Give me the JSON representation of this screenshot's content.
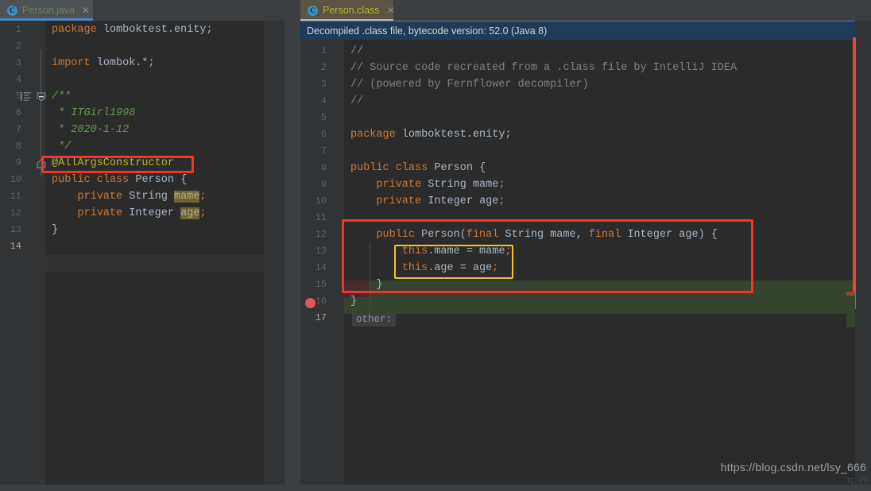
{
  "app": {
    "theme": "darcula",
    "watermark": "https://blog.csdn.net/lsy_666",
    "watermark_sub": "5.0",
    "accent_blue": "#4a88c7",
    "annotation_red": "#f5342a",
    "annotation_yellow": "#f0c419"
  },
  "tabs": [
    {
      "id": "tab-java",
      "label": "Person.java",
      "icon": "java-class-icon",
      "close_icon": "close-icon",
      "active": false,
      "underlined": true
    },
    {
      "id": "tab-class",
      "label": "Person.class",
      "icon": "java-class-icon",
      "close_icon": "close-icon",
      "active": true,
      "underlined": true
    }
  ],
  "left_editor": {
    "name": "Person.java",
    "cursor_line": 14,
    "line_numbers": [
      1,
      2,
      3,
      4,
      5,
      6,
      7,
      8,
      9,
      10,
      11,
      12,
      13,
      14
    ],
    "lines": [
      {
        "n": 1,
        "text": "package lomboktest.enity;"
      },
      {
        "n": 2,
        "text": ""
      },
      {
        "n": 3,
        "text": "import lombok.*;"
      },
      {
        "n": 4,
        "text": ""
      },
      {
        "n": 5,
        "text": "/**"
      },
      {
        "n": 6,
        "text": " * ITGirl1998"
      },
      {
        "n": 7,
        "text": " * 2020-1-12"
      },
      {
        "n": 8,
        "text": " */"
      },
      {
        "n": 9,
        "text": "@AllArgsConstructor"
      },
      {
        "n": 10,
        "text": "public class Person {"
      },
      {
        "n": 11,
        "text": "    private String mame;"
      },
      {
        "n": 12,
        "text": "    private Integer age;"
      },
      {
        "n": 13,
        "text": "}"
      },
      {
        "n": 14,
        "text": ""
      }
    ],
    "gutter_icons": [
      "reformat-icon",
      "fold-collapse-icon",
      "fold-end-icon"
    ],
    "stripe_markers": [
      "warning-square",
      "warning-line",
      "warning-line"
    ]
  },
  "right_editor": {
    "name": "Person.class",
    "notice": "Decompiled .class file, bytecode version: 52.0 (Java 8)",
    "breakpoint_line": 15,
    "line_numbers": [
      1,
      2,
      3,
      4,
      5,
      6,
      7,
      8,
      9,
      10,
      11,
      12,
      13,
      14,
      15,
      16,
      17
    ],
    "lines": [
      {
        "n": 1,
        "text": "//"
      },
      {
        "n": 2,
        "text": "// Source code recreated from a .class file by IntelliJ IDEA"
      },
      {
        "n": 3,
        "text": "// (powered by Fernflower decompiler)"
      },
      {
        "n": 4,
        "text": "//"
      },
      {
        "n": 5,
        "text": ""
      },
      {
        "n": 6,
        "text": "package lomboktest.enity;"
      },
      {
        "n": 7,
        "text": ""
      },
      {
        "n": 8,
        "text": "public class Person {"
      },
      {
        "n": 9,
        "text": "    private String mame;"
      },
      {
        "n": 10,
        "text": "    private Integer age;"
      },
      {
        "n": 11,
        "text": ""
      },
      {
        "n": 12,
        "text": "    public Person(final String mame, final Integer age) {"
      },
      {
        "n": 13,
        "text": "        this.mame = mame;"
      },
      {
        "n": 14,
        "text": "        this.age = age;"
      },
      {
        "n": 15,
        "text": "    }"
      },
      {
        "n": 16,
        "text": "}"
      },
      {
        "n": 17,
        "text": "other:"
      }
    ],
    "chip_label": "other:"
  },
  "annotations": [
    {
      "id": "red-box-annotation",
      "target": "@AllArgsConstructor"
    },
    {
      "id": "red-box-constructor",
      "target": "generated constructor"
    },
    {
      "id": "yellow-box-assignments",
      "target": "field assignments"
    }
  ]
}
